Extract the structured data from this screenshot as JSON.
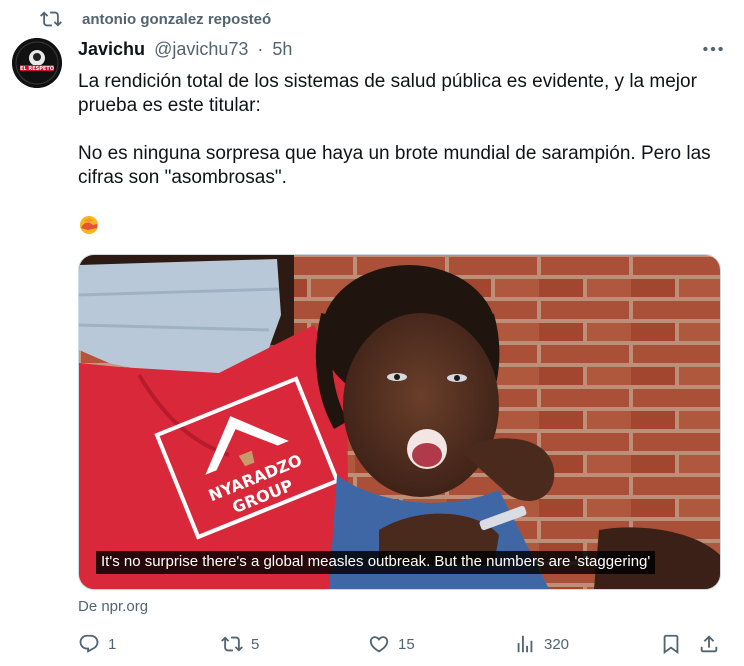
{
  "repost": {
    "text": "antonio gonzalez reposteó",
    "icon": "repost-icon"
  },
  "author": {
    "display_name": "Javichu",
    "handle": "@javichu73",
    "separator": "·",
    "time": "5h",
    "avatar_label": "EL RESPETO"
  },
  "tweet": {
    "line1": "La rendición total de los sistemas de salud pública es evidente, y la mejor prueba es este titular:",
    "line2": "No es ninguna sorpresa que haya un brote mundial de sarampión. Pero las cifras son \"asombrosas\".",
    "emoji": "🤦"
  },
  "media": {
    "caption": "It's no surprise there's a global measles outbreak. But the numbers are 'staggering'",
    "shirt_text_1": "NYARADZO",
    "shirt_text_2": "GROUP"
  },
  "source": "De npr.org",
  "actions": {
    "replies": "1",
    "reposts": "5",
    "likes": "15",
    "views": "320"
  },
  "colors": {
    "text_primary": "#0f1419",
    "text_secondary": "#536471",
    "border": "#cfd9de",
    "brick": "#b5553a",
    "shirt": "#d8283a"
  }
}
